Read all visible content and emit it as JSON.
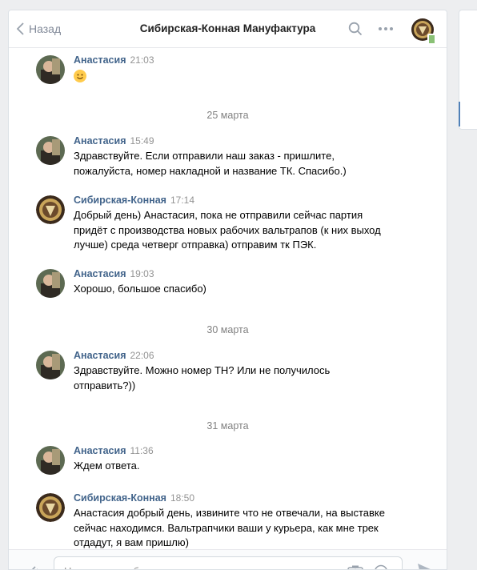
{
  "header": {
    "back_label": "Назад",
    "title": "Сибирская-Конная Мануфактура"
  },
  "messages": [
    {
      "author": "Анастасия",
      "time": "21:03",
      "text": ""
    },
    {
      "author": "Анастасия",
      "time": "15:49",
      "text": "Здравствуйте. Если отправили наш заказ - пришлите, пожалуйста, номер накладной и название ТК. Спасибо.)"
    },
    {
      "author": "Сибирская-Конная",
      "time": "17:14",
      "text": "Добрый день) Анастасия, пока не отправили сейчас партия придёт с производства новых рабочих вальтрапов (к них выход лучше) среда четверг отправка) отправим тк ПЭК."
    },
    {
      "author": "Анастасия",
      "time": "19:03",
      "text": "Хорошо, большое спасибо)"
    },
    {
      "author": "Анастасия",
      "time": "22:06",
      "text": "Здравствуйте. Можно номер ТН? Или не получилось отправить?))"
    },
    {
      "author": "Анастасия",
      "time": "11:36",
      "text": "Ждем ответа."
    },
    {
      "author": "Сибирская-Конная",
      "time": "18:50",
      "text": "Анастасия добрый день, извините что не отвечали, на выставке сейчас находимся. Вальтрапчики ваши у курьера, как мне трек отдадут, я вам пришлю)"
    }
  ],
  "dates": [
    "25 марта",
    "30 марта",
    "31 марта"
  ],
  "composer": {
    "placeholder": "Напишите сообщение..."
  },
  "colors": {
    "accent": "#5181b8",
    "author": "#42648b",
    "online": "#8ac176"
  }
}
